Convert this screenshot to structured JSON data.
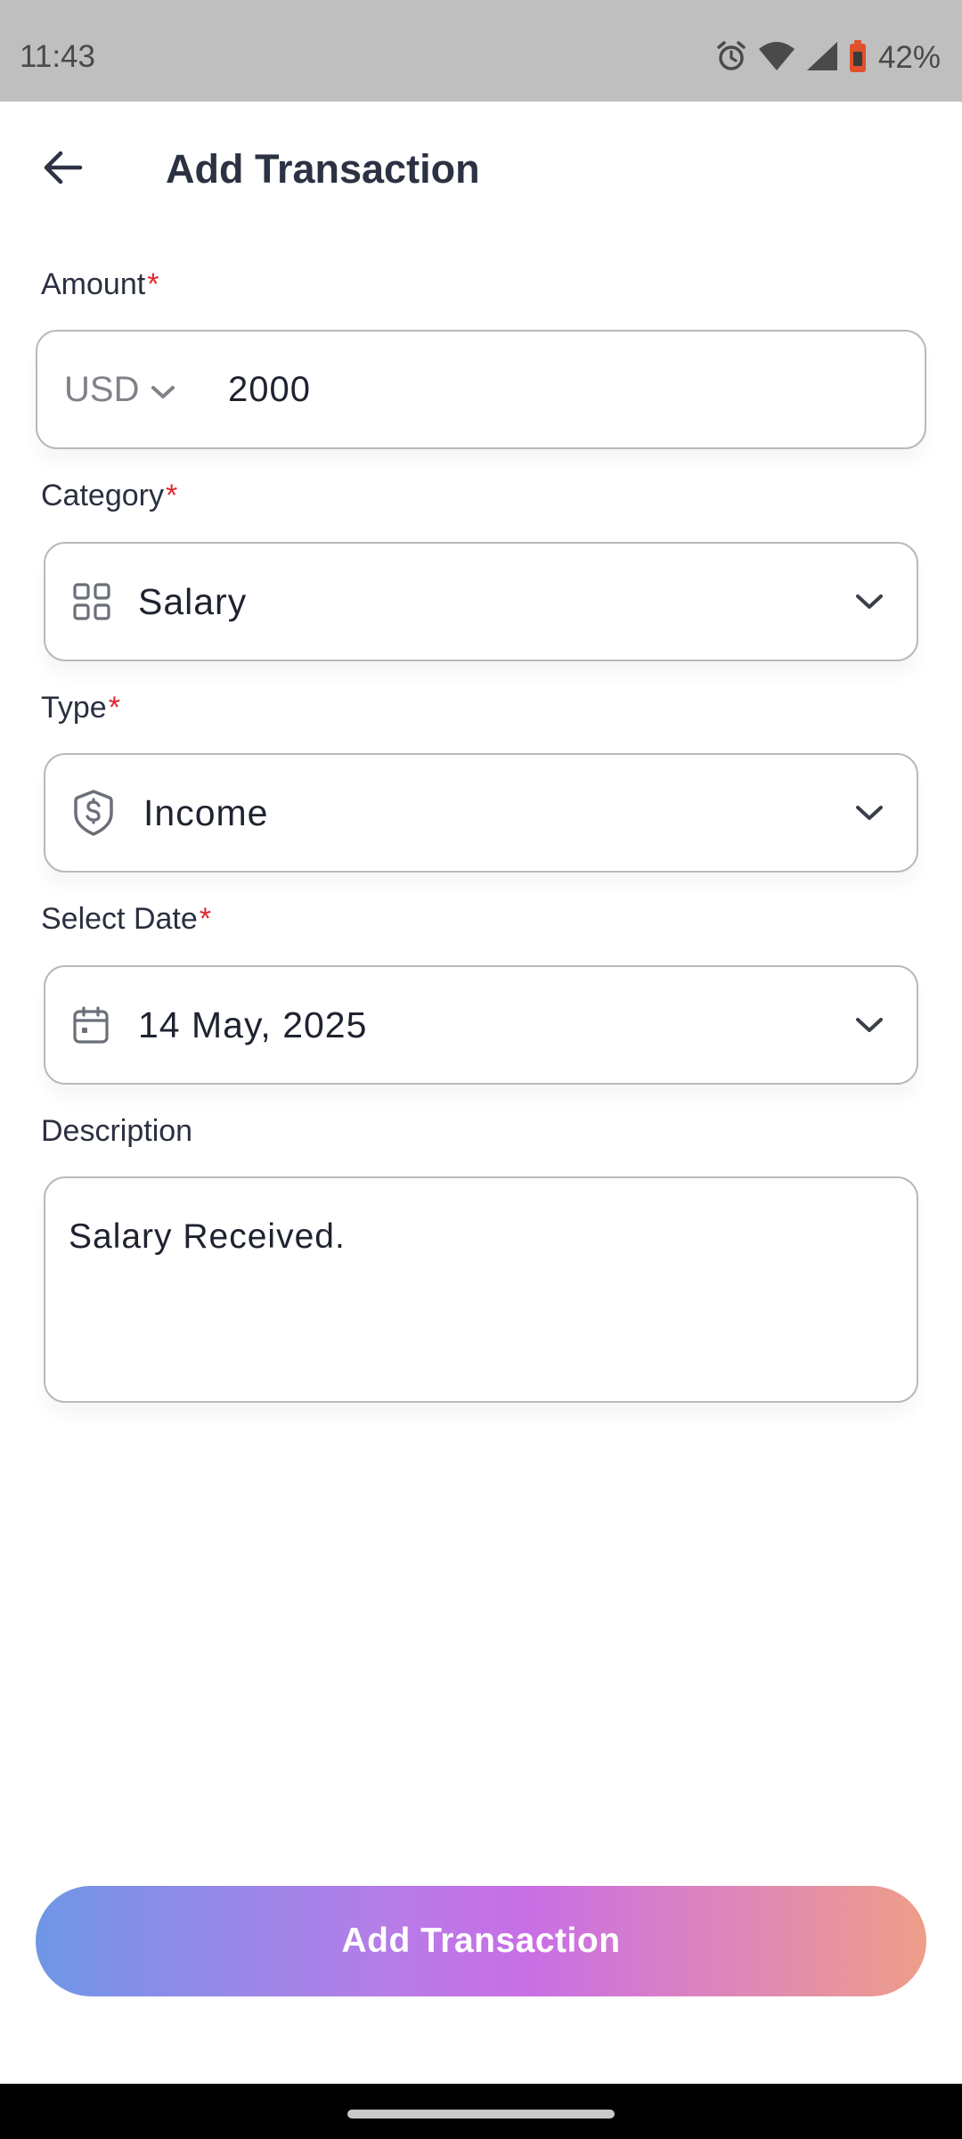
{
  "status_bar": {
    "time": "11:43",
    "battery_text": "42%",
    "icons": [
      "alarm-icon",
      "wifi-icon",
      "signal-icon",
      "battery-icon"
    ]
  },
  "header": {
    "title": "Add Transaction",
    "back_icon": "arrow-left-icon"
  },
  "form": {
    "amount": {
      "label": "Amount",
      "required_mark": "*",
      "currency": "USD",
      "value": "2000"
    },
    "category": {
      "label": "Category",
      "required_mark": "*",
      "value": "Salary",
      "icon": "grid-icon"
    },
    "type": {
      "label": "Type",
      "required_mark": "*",
      "value": "Income",
      "icon": "shield-dollar-icon"
    },
    "date": {
      "label": "Select Date",
      "required_mark": "*",
      "value": "14 May, 2025",
      "icon": "calendar-icon"
    },
    "description": {
      "label": "Description",
      "value": "Salary Received."
    }
  },
  "submit": {
    "label": "Add Transaction"
  },
  "colors": {
    "required": "#e0262f",
    "title": "#2c3243",
    "gradient_start": "#6f96e6",
    "gradient_mid": "#c86ee6",
    "gradient_end": "#ee9e88"
  }
}
